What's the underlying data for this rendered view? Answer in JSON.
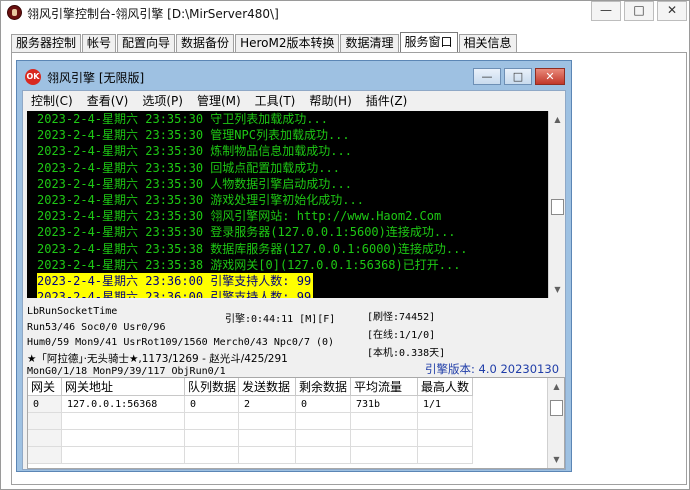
{
  "window": {
    "title": "翎风引擎控制台-翎风引擎 [D:\\MirServer480\\]",
    "buttons": [
      "—",
      "□",
      "✕"
    ]
  },
  "tabs": [
    {
      "label": "服务器控制",
      "active": false
    },
    {
      "label": "帐号",
      "active": false
    },
    {
      "label": "配置向导",
      "active": false
    },
    {
      "label": "数据备份",
      "active": false
    },
    {
      "label": "HeroM2版本转换",
      "active": false
    },
    {
      "label": "数据清理",
      "active": false
    },
    {
      "label": "服务窗口",
      "active": true
    },
    {
      "label": "相关信息",
      "active": false
    }
  ],
  "inner": {
    "icon_text": "OK",
    "title": "翎风引擎 [无限版]",
    "menu": [
      "控制(C)",
      "查看(V)",
      "选项(P)",
      "管理(M)",
      "工具(T)",
      "帮助(H)",
      "插件(Z)"
    ]
  },
  "console": {
    "lines": [
      "2023-2-4-星期六 23:35:30 守卫列表加载成功...",
      "2023-2-4-星期六 23:35:30 管理NPC列表加载成功...",
      "2023-2-4-星期六 23:35:30 炼制物品信息加载成功...",
      "2023-2-4-星期六 23:35:30 回城点配置加载成功...",
      "2023-2-4-星期六 23:35:30 人物数据引擎启动成功...",
      "2023-2-4-星期六 23:35:30 游戏处理引擎初始化成功...",
      "2023-2-4-星期六 23:35:30 翎风引擎网站: http://www.Haom2.Com",
      "2023-2-4-星期六 23:35:30 登录服务器(127.0.0.1:5600)连接成功...",
      "2023-2-4-星期六 23:35:38 数据库服务器(127.0.0.1:6000)连接成功...",
      "2023-2-4-星期六 23:35:38 游戏网关[0](127.0.0.1:56368)已打开..."
    ],
    "highlight_lines": [
      "2023-2-4-星期六 23:36:00 引擎支持人数: 99",
      "2023-2-4-星期六 23:36:00 引擎支持人数: 99"
    ],
    "highlight_color": "#ffff00",
    "text_color": "#1ec814"
  },
  "status": {
    "socket_time": "LbRunSocketTime",
    "engine_time": "引擎:0:44:11 [M][F]",
    "refresh": "[刷怪:74452]",
    "run": "Run53/46 Soc0/0 Usr0/96",
    "online": "[在线:1/1/0]",
    "hum": "Hum0/59 Mon9/41 UsrRot109/1560 Merch0/43 Npc0/7 (0)",
    "local": "[本机:0.338天]",
    "player": "★「阿拉德」·无头骑士★,1173/1269 - 赵光斗/425/291",
    "mon": "MonG0/1/18 MonP9/39/117 ObjRun0/1",
    "version": "引擎版本: 4.0 20230130"
  },
  "grid": {
    "headers": [
      "网关",
      "网关地址",
      "队列数据",
      "发送数据",
      "剩余数据",
      "平均流量",
      "最高人数"
    ],
    "rows": [
      [
        "0",
        "127.0.0.1:56368",
        "0",
        "2",
        "0",
        "731b",
        "1/1"
      ]
    ]
  }
}
